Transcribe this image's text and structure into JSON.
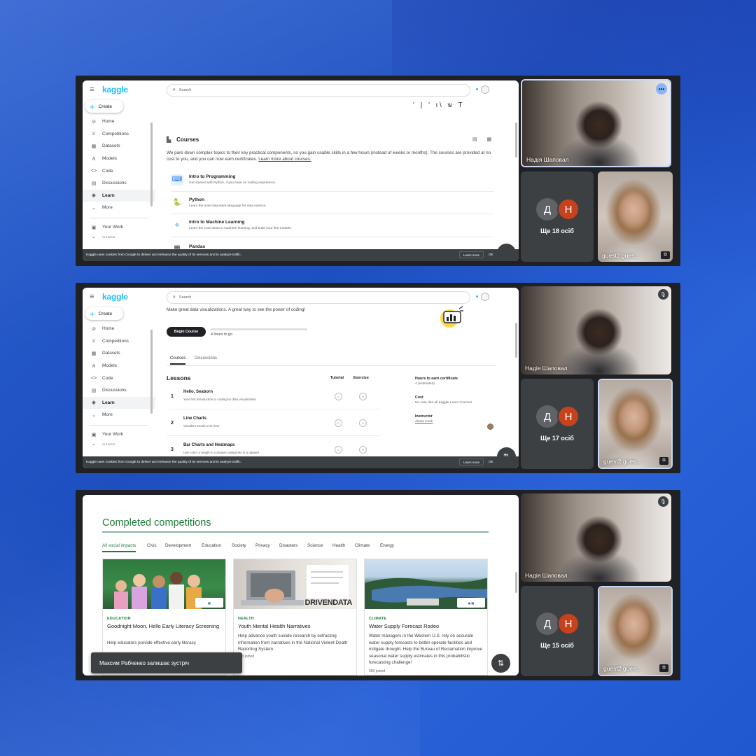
{
  "kaggle": {
    "logo": "kaggle",
    "create_label": "Create",
    "search_placeholder": "Search",
    "nav": [
      {
        "icon": "compass-icon",
        "glyph": "⊘",
        "label": "Home"
      },
      {
        "icon": "trophy-icon",
        "glyph": "♕",
        "label": "Competitions"
      },
      {
        "icon": "table-icon",
        "glyph": "▦",
        "label": "Datasets"
      },
      {
        "icon": "models-icon",
        "glyph": "⋔",
        "label": "Models"
      },
      {
        "icon": "code-icon",
        "glyph": "<>",
        "label": "Code"
      },
      {
        "icon": "discussions-icon",
        "glyph": "▤",
        "label": "Discussions"
      },
      {
        "icon": "learn-icon",
        "glyph": "◈",
        "label": "Learn"
      },
      {
        "icon": "chevron-down-icon",
        "glyph": "⌄",
        "label": "More"
      },
      {
        "icon": "your-work-icon",
        "glyph": "▣",
        "label": "Your Work"
      }
    ],
    "viewed_label": "VIEWED",
    "cookie_text": "Kaggle uses cookies from Google to deliver and enhance the quality of its services and to analyze traffic.",
    "cookie_learn_more": "Learn more",
    "cookie_ok": "OK"
  },
  "panel1": {
    "doodle": "' | ' ι\\ ѡ T",
    "courses_title": "Courses",
    "courses_desc": "We pare down complex topics to their key practical components, so you gain usable skills in a few hours (instead of weeks or months). The courses are provided at no cost to you, and you can now earn certificates.",
    "courses_link": "Learn more about courses.",
    "courses": [
      {
        "name": "Intro to Programming",
        "sub": "Get started with Python, if you have no coding experience."
      },
      {
        "name": "Python",
        "sub": "Learn the most important language for data science."
      },
      {
        "name": "Intro to Machine Learning",
        "sub": "Learn the core ideas in machine learning, and build your first models."
      },
      {
        "name": "Pandas",
        "sub": ""
      }
    ]
  },
  "panel2": {
    "desc": "Make great data visualizations. A great way to see the power of coding!",
    "begin": "Begin Course",
    "hours": "4 hours to go",
    "tabs": [
      "Courses",
      "Discussions"
    ],
    "lessons_title": "Lessons",
    "col_tutorial": "Tutorial",
    "col_exercise": "Exercise",
    "lessons": [
      {
        "num": "1",
        "name": "Hello, Seaborn",
        "sub": "Your first introduction to coding for data visualization"
      },
      {
        "num": "2",
        "name": "Line Charts",
        "sub": "Visualize trends over time"
      },
      {
        "num": "3",
        "name": "Bar Charts and Heatmaps",
        "sub": "Use color or length to compare categories in a dataset"
      }
    ],
    "info": [
      {
        "h": "Hours to earn certificate",
        "v": "4 (estimated)"
      },
      {
        "h": "Cost",
        "v": "No cost, like all Kaggle Learn Courses"
      },
      {
        "h": "Instructor",
        "v": "Alexis Cook"
      }
    ]
  },
  "panel3": {
    "title": "Completed competitions",
    "tabs": [
      "All social impacts",
      "Civic",
      "Development",
      "Education",
      "Society",
      "Privacy",
      "Disasters",
      "Science",
      "Health",
      "Climate",
      "Energy"
    ],
    "cards": [
      {
        "cat": "EDUCATION",
        "name": "Goodnight Moon, Hello Early Literacy Screening",
        "desc": "Help educators provide effective early literacy",
        "joined": ""
      },
      {
        "cat": "HEALTH",
        "name": "Youth Mental Health Narratives",
        "desc": "Help advance youth suicide research by extracting information from narratives in the National Violent Death Reporting System.",
        "joined": "763 joined",
        "logo": "DRIVENDATA"
      },
      {
        "cat": "CLIMATE",
        "name": "Water Supply Forecast Rodeo",
        "desc": "Water managers in the Western U.S. rely on accurate water supply forecasts to better operate facilities and mitigate drought. Help the Bureau of Reclamation improve seasonal water supply estimates in this probabilistic forecasting challenge!",
        "joined": "560 joined"
      }
    ],
    "toast": "Максим Рабченко залишає зустріч"
  },
  "meet": {
    "host_name": "Надія Шаповал",
    "guest_name": "guest2 gues...",
    "avatar_d": "Д",
    "avatar_n": "Н",
    "more_1": "Ще 18 осіб",
    "more_2": "Ще 17 осіб",
    "more_3": "Ще 15 осіб"
  },
  "colors": {
    "background": "#2458cc",
    "kaggle_blue": "#20beff",
    "meet_dark": "#202124",
    "competitions_green": "#1e7b3a",
    "avatar_n": "#c5421d"
  }
}
